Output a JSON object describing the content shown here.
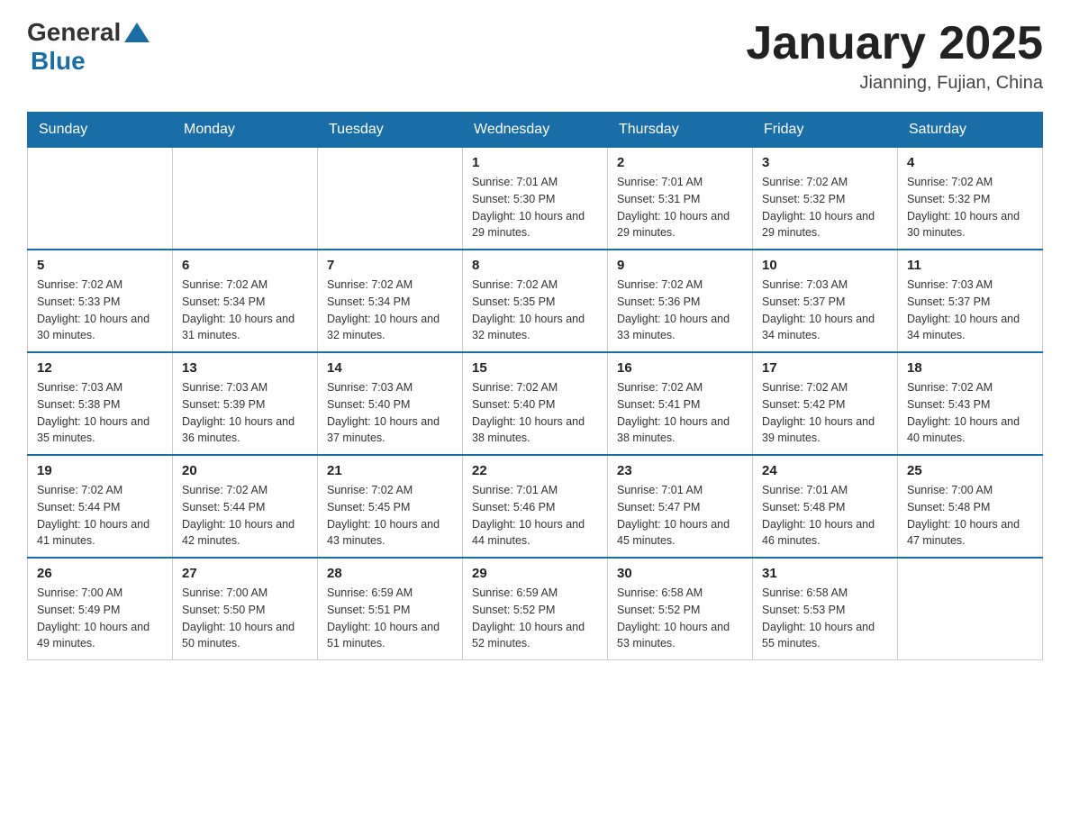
{
  "logo": {
    "general": "General",
    "blue": "Blue"
  },
  "title": "January 2025",
  "location": "Jianning, Fujian, China",
  "days_of_week": [
    "Sunday",
    "Monday",
    "Tuesday",
    "Wednesday",
    "Thursday",
    "Friday",
    "Saturday"
  ],
  "weeks": [
    [
      {
        "day": "",
        "info": ""
      },
      {
        "day": "",
        "info": ""
      },
      {
        "day": "",
        "info": ""
      },
      {
        "day": "1",
        "info": "Sunrise: 7:01 AM\nSunset: 5:30 PM\nDaylight: 10 hours and 29 minutes."
      },
      {
        "day": "2",
        "info": "Sunrise: 7:01 AM\nSunset: 5:31 PM\nDaylight: 10 hours and 29 minutes."
      },
      {
        "day": "3",
        "info": "Sunrise: 7:02 AM\nSunset: 5:32 PM\nDaylight: 10 hours and 29 minutes."
      },
      {
        "day": "4",
        "info": "Sunrise: 7:02 AM\nSunset: 5:32 PM\nDaylight: 10 hours and 30 minutes."
      }
    ],
    [
      {
        "day": "5",
        "info": "Sunrise: 7:02 AM\nSunset: 5:33 PM\nDaylight: 10 hours and 30 minutes."
      },
      {
        "day": "6",
        "info": "Sunrise: 7:02 AM\nSunset: 5:34 PM\nDaylight: 10 hours and 31 minutes."
      },
      {
        "day": "7",
        "info": "Sunrise: 7:02 AM\nSunset: 5:34 PM\nDaylight: 10 hours and 32 minutes."
      },
      {
        "day": "8",
        "info": "Sunrise: 7:02 AM\nSunset: 5:35 PM\nDaylight: 10 hours and 32 minutes."
      },
      {
        "day": "9",
        "info": "Sunrise: 7:02 AM\nSunset: 5:36 PM\nDaylight: 10 hours and 33 minutes."
      },
      {
        "day": "10",
        "info": "Sunrise: 7:03 AM\nSunset: 5:37 PM\nDaylight: 10 hours and 34 minutes."
      },
      {
        "day": "11",
        "info": "Sunrise: 7:03 AM\nSunset: 5:37 PM\nDaylight: 10 hours and 34 minutes."
      }
    ],
    [
      {
        "day": "12",
        "info": "Sunrise: 7:03 AM\nSunset: 5:38 PM\nDaylight: 10 hours and 35 minutes."
      },
      {
        "day": "13",
        "info": "Sunrise: 7:03 AM\nSunset: 5:39 PM\nDaylight: 10 hours and 36 minutes."
      },
      {
        "day": "14",
        "info": "Sunrise: 7:03 AM\nSunset: 5:40 PM\nDaylight: 10 hours and 37 minutes."
      },
      {
        "day": "15",
        "info": "Sunrise: 7:02 AM\nSunset: 5:40 PM\nDaylight: 10 hours and 38 minutes."
      },
      {
        "day": "16",
        "info": "Sunrise: 7:02 AM\nSunset: 5:41 PM\nDaylight: 10 hours and 38 minutes."
      },
      {
        "day": "17",
        "info": "Sunrise: 7:02 AM\nSunset: 5:42 PM\nDaylight: 10 hours and 39 minutes."
      },
      {
        "day": "18",
        "info": "Sunrise: 7:02 AM\nSunset: 5:43 PM\nDaylight: 10 hours and 40 minutes."
      }
    ],
    [
      {
        "day": "19",
        "info": "Sunrise: 7:02 AM\nSunset: 5:44 PM\nDaylight: 10 hours and 41 minutes."
      },
      {
        "day": "20",
        "info": "Sunrise: 7:02 AM\nSunset: 5:44 PM\nDaylight: 10 hours and 42 minutes."
      },
      {
        "day": "21",
        "info": "Sunrise: 7:02 AM\nSunset: 5:45 PM\nDaylight: 10 hours and 43 minutes."
      },
      {
        "day": "22",
        "info": "Sunrise: 7:01 AM\nSunset: 5:46 PM\nDaylight: 10 hours and 44 minutes."
      },
      {
        "day": "23",
        "info": "Sunrise: 7:01 AM\nSunset: 5:47 PM\nDaylight: 10 hours and 45 minutes."
      },
      {
        "day": "24",
        "info": "Sunrise: 7:01 AM\nSunset: 5:48 PM\nDaylight: 10 hours and 46 minutes."
      },
      {
        "day": "25",
        "info": "Sunrise: 7:00 AM\nSunset: 5:48 PM\nDaylight: 10 hours and 47 minutes."
      }
    ],
    [
      {
        "day": "26",
        "info": "Sunrise: 7:00 AM\nSunset: 5:49 PM\nDaylight: 10 hours and 49 minutes."
      },
      {
        "day": "27",
        "info": "Sunrise: 7:00 AM\nSunset: 5:50 PM\nDaylight: 10 hours and 50 minutes."
      },
      {
        "day": "28",
        "info": "Sunrise: 6:59 AM\nSunset: 5:51 PM\nDaylight: 10 hours and 51 minutes."
      },
      {
        "day": "29",
        "info": "Sunrise: 6:59 AM\nSunset: 5:52 PM\nDaylight: 10 hours and 52 minutes."
      },
      {
        "day": "30",
        "info": "Sunrise: 6:58 AM\nSunset: 5:52 PM\nDaylight: 10 hours and 53 minutes."
      },
      {
        "day": "31",
        "info": "Sunrise: 6:58 AM\nSunset: 5:53 PM\nDaylight: 10 hours and 55 minutes."
      },
      {
        "day": "",
        "info": ""
      }
    ]
  ]
}
